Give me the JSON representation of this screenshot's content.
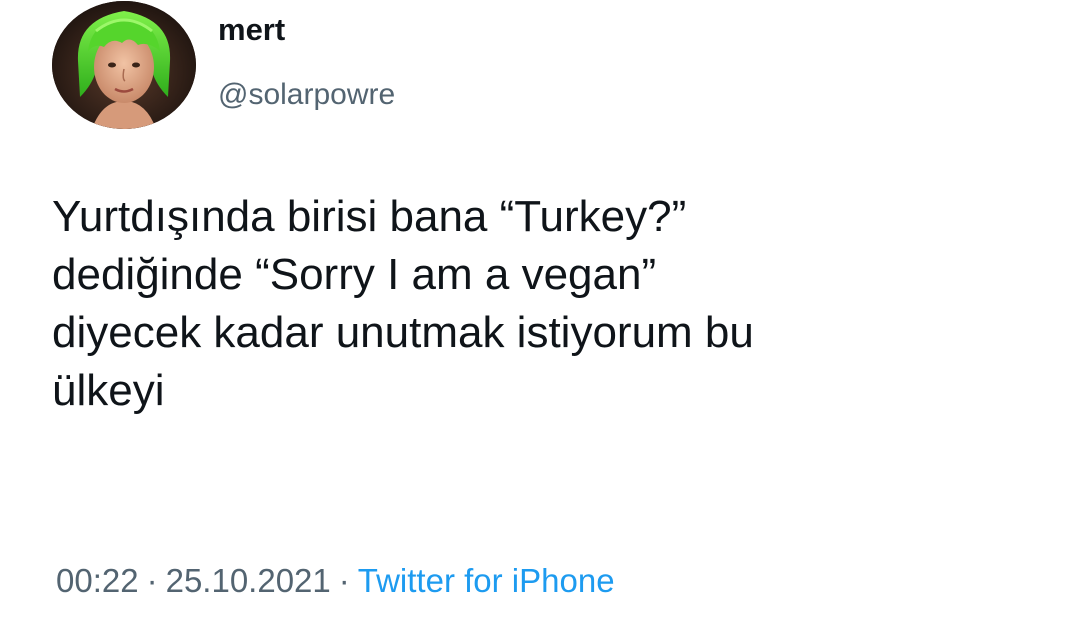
{
  "author": {
    "display_name": "mert",
    "handle": "@solarpowre",
    "avatar_icon": "profile-photo"
  },
  "tweet": {
    "lines": [
      "Yurtdışında birisi bana “Turkey?”",
      "dediğinde “Sorry I am a vegan”",
      "diyecek kadar unutmak istiyorum bu",
      "ülkeyi"
    ]
  },
  "meta": {
    "time": "00:22",
    "separator": "·",
    "date": "25.10.2021",
    "source": "Twitter for iPhone"
  },
  "colors": {
    "text": "#0f1419",
    "secondary": "#536471",
    "link": "#1d9bf0",
    "wig_green": "#4fd12a"
  }
}
